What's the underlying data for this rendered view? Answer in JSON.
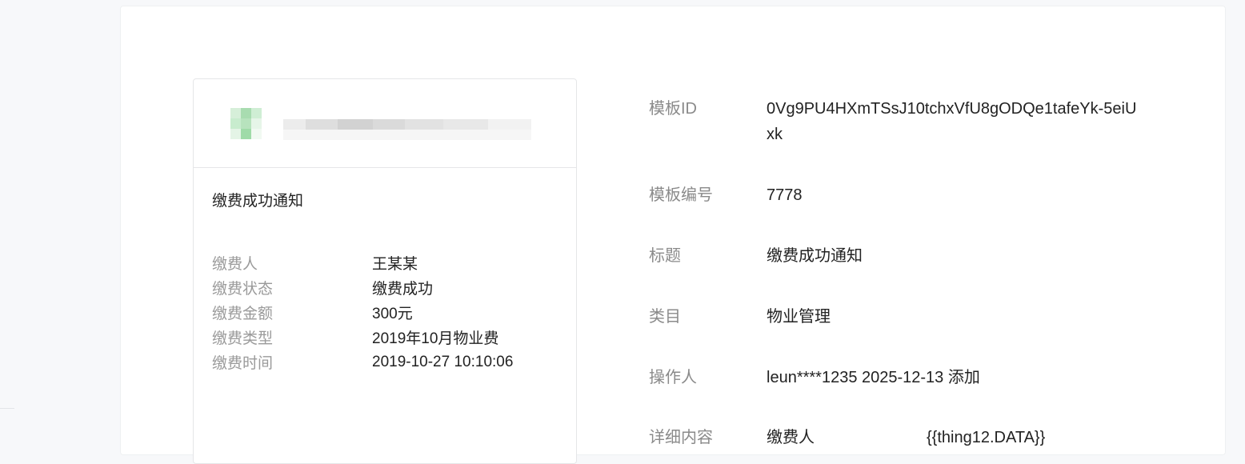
{
  "preview": {
    "title": "缴费成功通知",
    "fields": [
      {
        "label": "缴费人",
        "value": "王某某"
      },
      {
        "label": "缴费状态",
        "value": "缴费成功"
      },
      {
        "label": "缴费金额",
        "value": "300元"
      },
      {
        "label": "缴费类型",
        "value": "2019年10月物业费"
      },
      {
        "label": "缴费时间",
        "value": "2019-10-27 10:10:06"
      }
    ]
  },
  "info": {
    "template_id": {
      "label": "模板ID",
      "value": "0Vg9PU4HXmTSsJ10tchxVfU8gODQe1tafeYk-5eiUxk"
    },
    "template_no": {
      "label": "模板编号",
      "value": "7778"
    },
    "title": {
      "label": "标题",
      "value": "缴费成功通知"
    },
    "category": {
      "label": "类目",
      "value": "物业管理"
    },
    "operator": {
      "label": "操作人",
      "value": "leun****1235 2025-12-13 添加"
    },
    "detail": {
      "label": "详细内容",
      "field_label": "缴费人",
      "field_value": "{{thing12.DATA}}"
    }
  },
  "colors": {
    "label_gray": "#8a8a8a",
    "text_dark": "#222222",
    "border": "#e5e6e8",
    "avatar_green": "#a8dcb0"
  },
  "icons": {
    "avatar": "blurred-avatar-icon",
    "account_name": "blurred-account-name"
  }
}
